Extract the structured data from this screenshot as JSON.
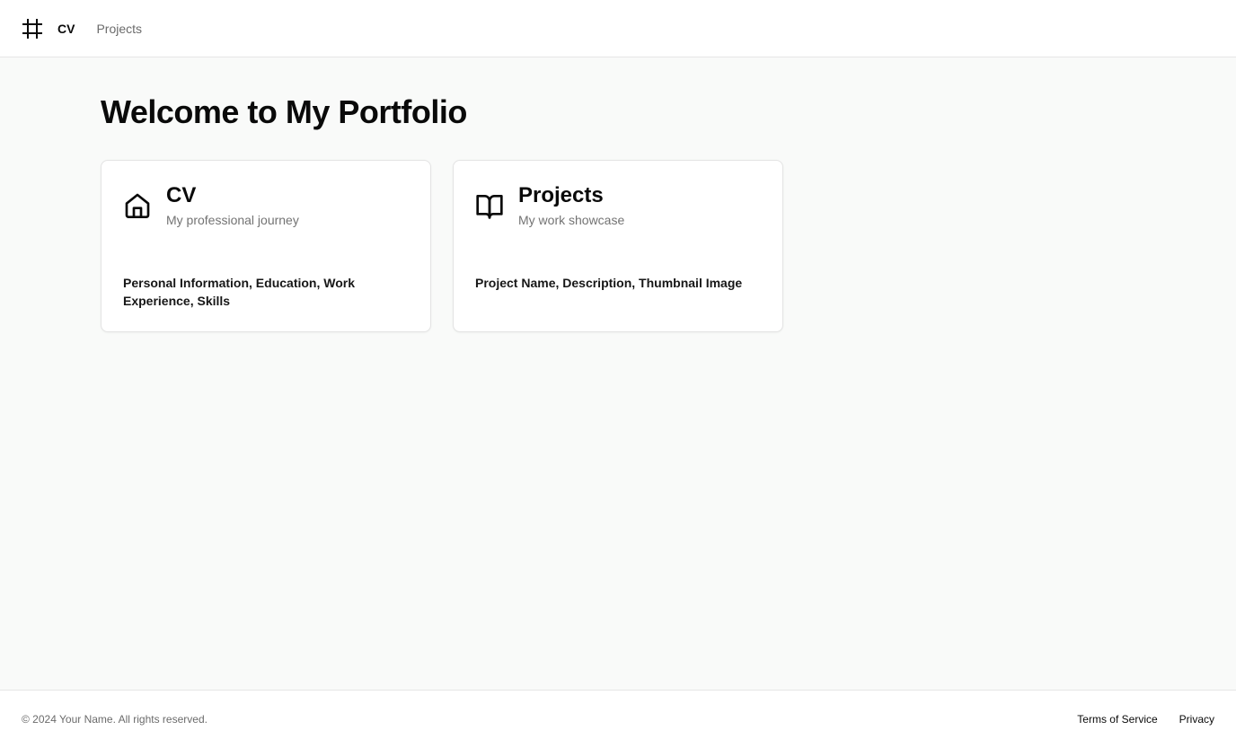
{
  "header": {
    "logo_icon": "hash-icon",
    "nav": [
      {
        "label": "CV",
        "active": true
      },
      {
        "label": "Projects",
        "active": false
      }
    ]
  },
  "main": {
    "title": "Welcome to My Portfolio",
    "cards": [
      {
        "icon": "home-icon",
        "title": "CV",
        "subtitle": "My professional journey",
        "body": "Personal Information, Education, Work Experience, Skills"
      },
      {
        "icon": "book-open-icon",
        "title": "Projects",
        "subtitle": "My work showcase",
        "body": "Project Name, Description, Thumbnail Image"
      }
    ]
  },
  "footer": {
    "copyright": "© 2024 Your Name. All rights reserved.",
    "links": [
      {
        "label": "Terms of Service"
      },
      {
        "label": "Privacy"
      }
    ]
  },
  "colors": {
    "background": "#f9faf9",
    "surface": "#ffffff",
    "text": "#0a0a0a",
    "muted": "#737373",
    "border": "#e3e3e3"
  }
}
